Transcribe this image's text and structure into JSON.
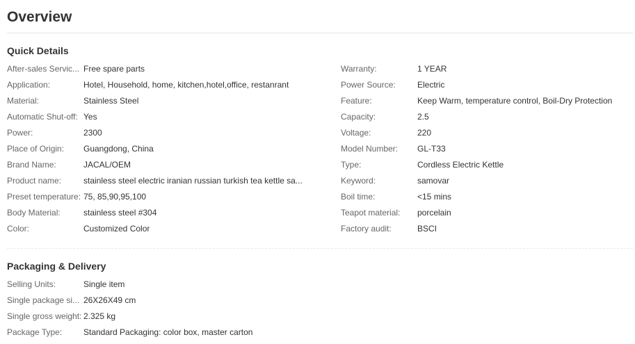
{
  "page": {
    "title": "Overview"
  },
  "quick_details": {
    "heading": "Quick Details",
    "left": [
      {
        "label": "After-sales Servic...",
        "value": "Free spare parts"
      },
      {
        "label": "Application:",
        "value": "Hotel, Household, home, kitchen,hotel,office, restanrant"
      },
      {
        "label": "Material:",
        "value": "Stainless Steel"
      },
      {
        "label": "Automatic Shut-off:",
        "value": "Yes"
      },
      {
        "label": "Power:",
        "value": "2300"
      },
      {
        "label": "Place of Origin:",
        "value": "Guangdong, China"
      },
      {
        "label": "Brand Name:",
        "value": "JACAL/OEM"
      },
      {
        "label": "Product name:",
        "value": "stainless steel electric iranian russian turkish tea kettle sa..."
      },
      {
        "label": "Preset temperature:",
        "value": "75, 85,90,95,100"
      },
      {
        "label": "Body Material:",
        "value": "stainless steel #304"
      },
      {
        "label": "Color:",
        "value": "Customized Color"
      }
    ],
    "right": [
      {
        "label": "Warranty:",
        "value": "1 YEAR"
      },
      {
        "label": "Power Source:",
        "value": "Electric"
      },
      {
        "label": "Feature:",
        "value": "Keep Warm, temperature control, Boil-Dry Protection"
      },
      {
        "label": "Capacity:",
        "value": "2.5"
      },
      {
        "label": "Voltage:",
        "value": "220"
      },
      {
        "label": "Model Number:",
        "value": "GL-T33"
      },
      {
        "label": "Type:",
        "value": "Cordless Electric Kettle"
      },
      {
        "label": "Keyword:",
        "value": "samovar"
      },
      {
        "label": "Boil time:",
        "value": "<15 mins"
      },
      {
        "label": "Teapot material:",
        "value": "porcelain"
      },
      {
        "label": "Factory audit:",
        "value": "BSCI"
      }
    ]
  },
  "packaging": {
    "heading": "Packaging & Delivery",
    "rows": [
      {
        "label": "Selling Units:",
        "value": "Single item"
      },
      {
        "label": "Single package si...",
        "value": "26X26X49 cm"
      },
      {
        "label": "Single gross weight:",
        "value": "2.325 kg"
      },
      {
        "label": "Package Type:",
        "value": "Standard Packaging: color box, master carton"
      }
    ]
  }
}
